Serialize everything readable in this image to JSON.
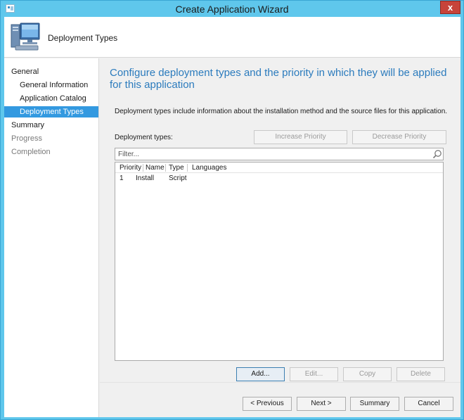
{
  "window": {
    "title": "Create Application Wizard",
    "close_label": "x"
  },
  "header": {
    "icon": "computer-monitor-icon",
    "title": "Deployment Types"
  },
  "nav": {
    "items": [
      {
        "label": "General",
        "level": "top",
        "state": "normal"
      },
      {
        "label": "General Information",
        "level": "sub",
        "state": "normal"
      },
      {
        "label": "Application Catalog",
        "level": "sub",
        "state": "normal"
      },
      {
        "label": "Deployment Types",
        "level": "sub",
        "state": "selected"
      },
      {
        "label": "Summary",
        "level": "top",
        "state": "normal"
      },
      {
        "label": "Progress",
        "level": "top",
        "state": "disabled"
      },
      {
        "label": "Completion",
        "level": "top",
        "state": "disabled"
      }
    ]
  },
  "main": {
    "heading": "Configure deployment types and the priority in which they will be applied for this application",
    "description": "Deployment types include information about the installation method and the source files for this application.",
    "deployment_types_label": "Deployment types:",
    "increase_priority": "Increase Priority",
    "decrease_priority": "Decrease Priority",
    "filter_placeholder": "Filter...",
    "columns": [
      "Priority",
      "Name",
      "Type",
      "Languages"
    ],
    "rows": [
      {
        "priority": "1",
        "name": "Install",
        "type": "Script",
        "languages": ""
      }
    ],
    "add": "Add...",
    "edit": "Edit...",
    "copy": "Copy",
    "delete": "Delete"
  },
  "footer": {
    "previous": "< Previous",
    "next": "Next >",
    "summary": "Summary",
    "cancel": "Cancel"
  },
  "colors": {
    "title_bar": "#5fc7ec",
    "accent_heading": "#2b7bbd",
    "nav_selected": "#3399e0",
    "close_button": "#c7443a"
  }
}
